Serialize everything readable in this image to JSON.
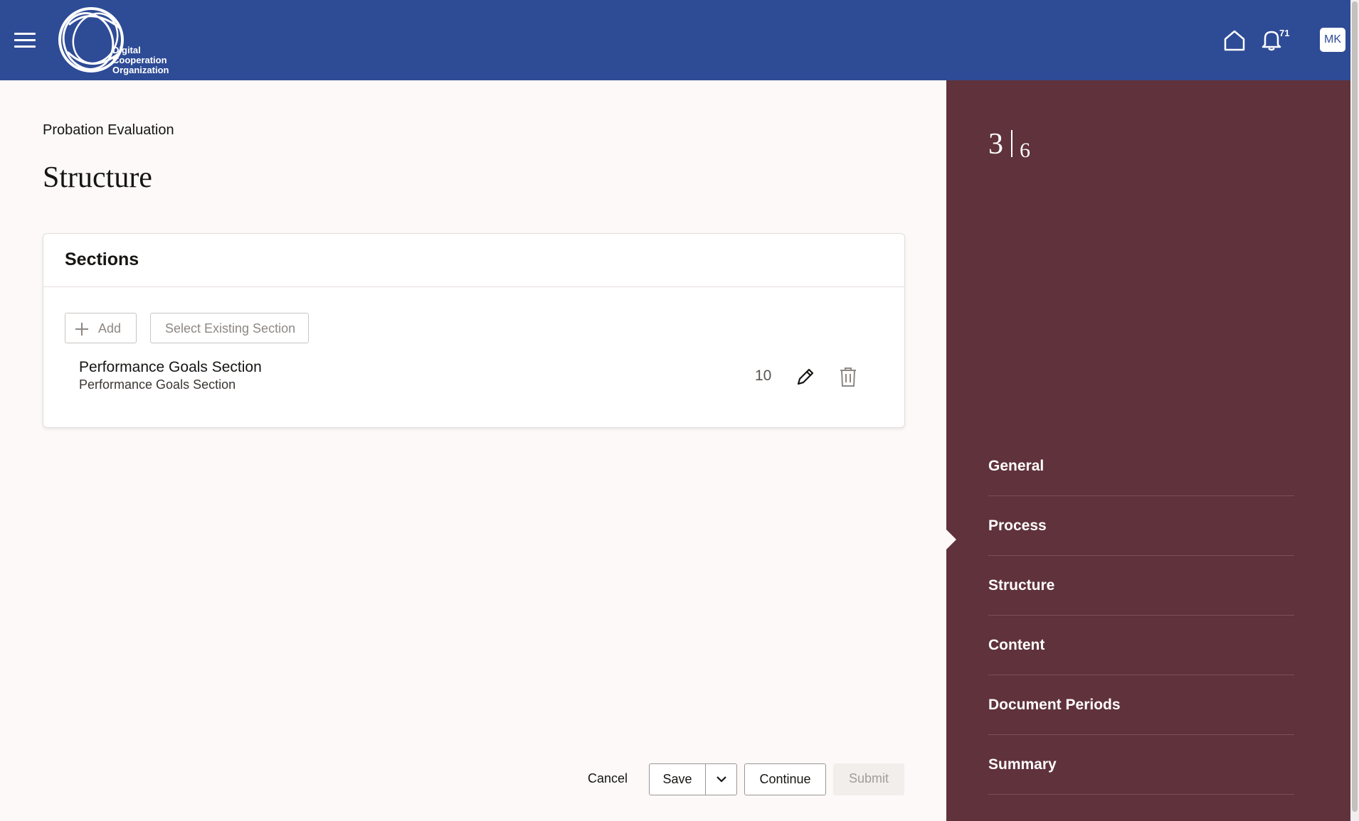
{
  "header": {
    "logo_lines": [
      "Digital",
      "Cooperation",
      "Organization"
    ],
    "notification_count": "71",
    "avatar_initials": "MK"
  },
  "page": {
    "breadcrumb": "Probation Evaluation",
    "title": "Structure"
  },
  "sections_card": {
    "title": "Sections",
    "add_label": "Add",
    "select_existing_label": "Select Existing Section",
    "items": [
      {
        "name": "Performance Goals Section",
        "description": "Performance Goals Section",
        "weight": "10"
      }
    ]
  },
  "actions": {
    "cancel": "Cancel",
    "save": "Save",
    "continue": "Continue",
    "submit": "Submit"
  },
  "train": {
    "current_step": "3",
    "total_steps": "6",
    "steps": [
      "General",
      "Process",
      "Structure",
      "Content",
      "Document Periods",
      "Summary"
    ],
    "current_index": 2
  },
  "colors": {
    "header_bg": "#2e4b96",
    "train_bg": "#60323c",
    "page_bg": "#fcf9f8"
  }
}
